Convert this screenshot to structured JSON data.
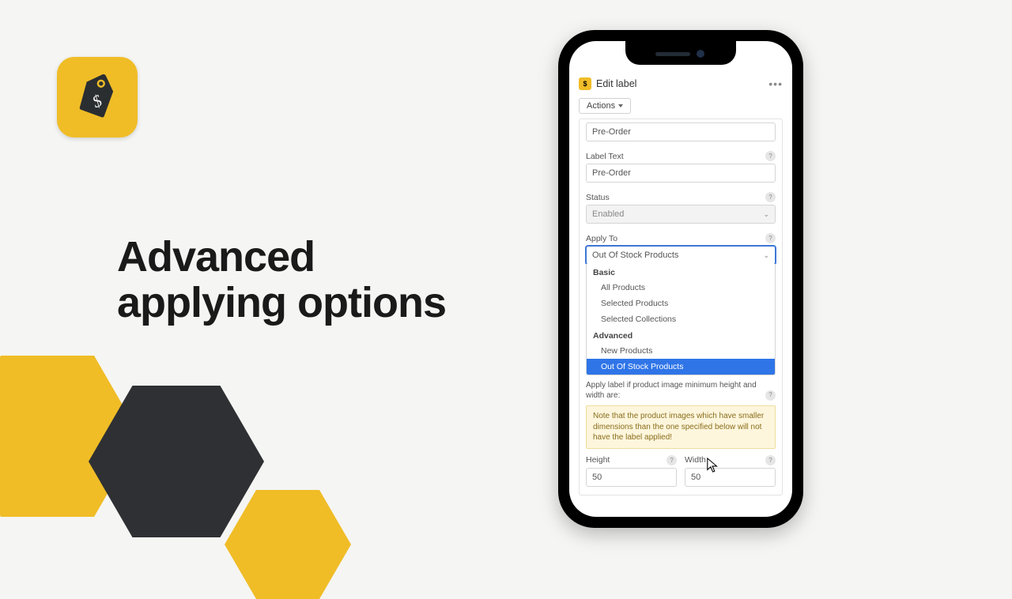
{
  "hero": {
    "headline_line1": "Advanced",
    "headline_line2": "applying options"
  },
  "phone": {
    "header": {
      "title": "Edit label",
      "more_glyph": "•••",
      "logo_letter": "$"
    },
    "actions_btn": "Actions",
    "labels": {
      "name_value": "Pre-Order",
      "label_text": "Label Text",
      "label_text_value": "Pre-Order",
      "status": "Status",
      "status_value": "Enabled",
      "apply_to": "Apply To",
      "apply_to_value": "Out Of Stock Products"
    },
    "dropdown": {
      "group_basic": "Basic",
      "basic_items": [
        "All Products",
        "Selected Products",
        "Selected Collections"
      ],
      "group_advanced": "Advanced",
      "advanced_items": [
        "New Products",
        "Out Of Stock Products"
      ]
    },
    "hint": "Apply label if product image minimum height and width are:",
    "note": "Note that the product images which have smaller dimensions than the one specified below will not have the label applied!",
    "dims": {
      "height_label": "Height",
      "height_value": "50",
      "width_label": "Width",
      "width_value": "50"
    }
  }
}
